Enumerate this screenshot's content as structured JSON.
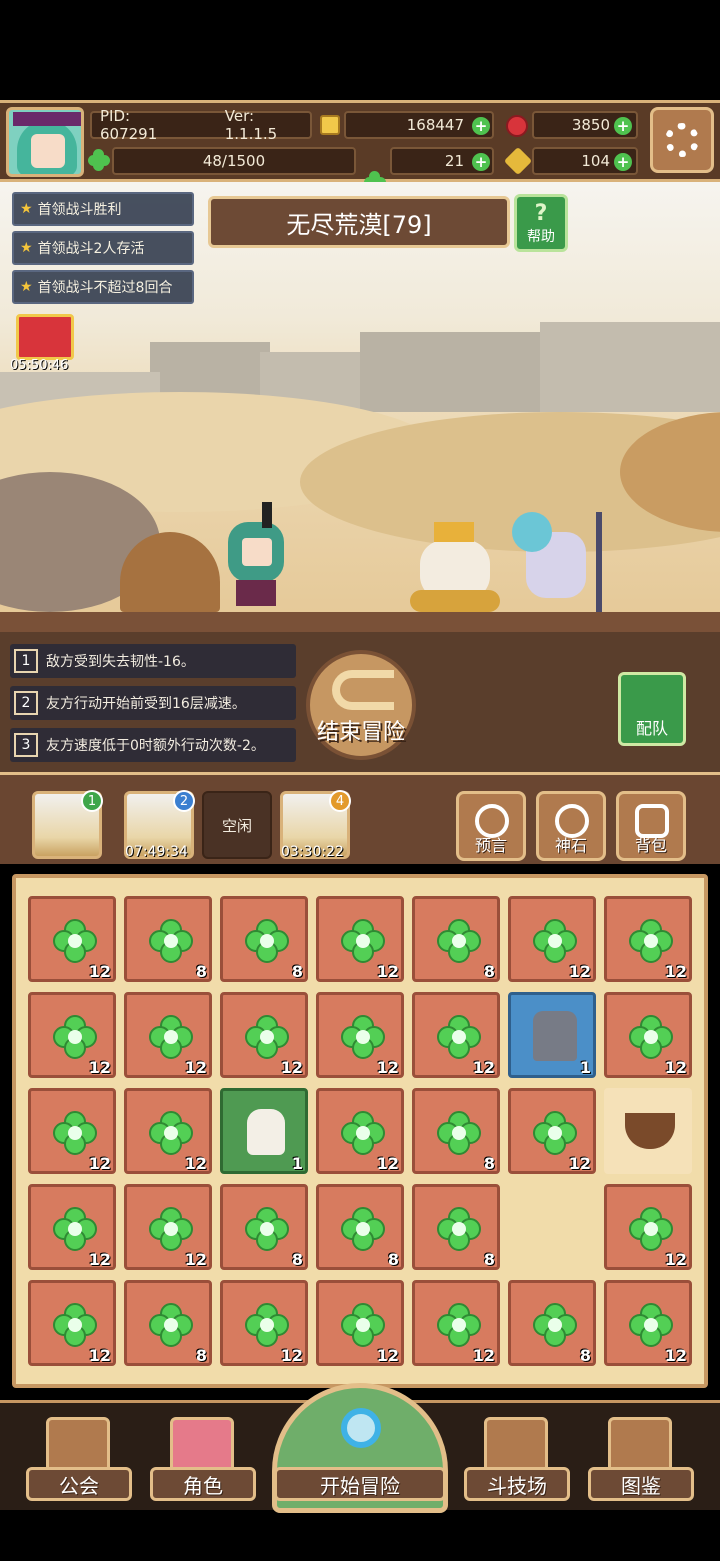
{
  "header": {
    "pid": "PID: 607291",
    "version": "Ver: 1.1.1.5",
    "gold": "168447",
    "ruby": "3850",
    "exp": "48/1500",
    "clover": "21",
    "key": "104"
  },
  "scene": {
    "stage_title": "无尽荒漠[79]",
    "help_label": "帮助",
    "help_icon": "?",
    "quests": [
      "首领战斗胜利",
      "首领战斗2人存活",
      "首领战斗不超过8回合"
    ],
    "gift_timer": "05:50:46"
  },
  "effects": [
    {
      "num": "1",
      "text": "敌方受到失去韧性-16。"
    },
    {
      "num": "2",
      "text": "友方行动开始前受到16层减速。"
    },
    {
      "num": "3",
      "text": "友方速度低于0时额外行动次数-2。"
    }
  ],
  "end_adventure": "结束冒险",
  "team_label": "配队",
  "slots": [
    {
      "badge": "1",
      "timer": ""
    },
    {
      "badge": "2",
      "timer": "07:49:34"
    },
    {
      "empty_label": "空闲"
    },
    {
      "badge": "4",
      "timer": "03:30:22"
    }
  ],
  "tools": [
    "预言",
    "神石",
    "背包"
  ],
  "inventory": [
    [
      "12",
      "8",
      "8",
      "12",
      "8",
      "12",
      "12"
    ],
    [
      "12",
      "12",
      "12",
      "12",
      "12",
      "1",
      "12"
    ],
    [
      "12",
      "12",
      "1",
      "12",
      "8",
      "12",
      ""
    ],
    [
      "12",
      "12",
      "8",
      "8",
      "8",
      "",
      "12"
    ],
    [
      "12",
      "8",
      "12",
      "12",
      "12",
      "8",
      "12"
    ]
  ],
  "nav": [
    "公会",
    "角色",
    "开始冒险",
    "斗技场",
    "图鉴"
  ],
  "colors": {
    "accent": "#e3be89",
    "panel": "#5a3e2c",
    "cell": "#d77b5f"
  }
}
